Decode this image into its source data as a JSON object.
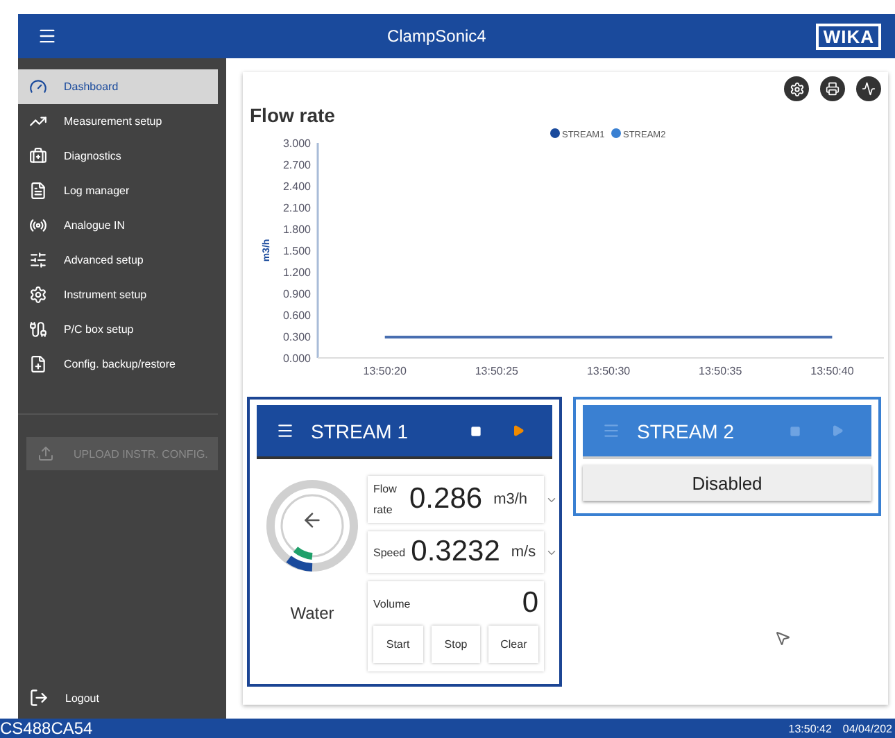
{
  "header": {
    "title": "ClampSonic4",
    "logo": "WIKA"
  },
  "sidebar": {
    "items": [
      {
        "label": "Dashboard",
        "selected": true
      },
      {
        "label": "Measurement setup",
        "selected": false
      },
      {
        "label": "Diagnostics",
        "selected": false
      },
      {
        "label": "Log manager",
        "selected": false
      },
      {
        "label": "Analogue IN",
        "selected": false
      },
      {
        "label": "Advanced setup",
        "selected": false
      },
      {
        "label": "Instrument setup",
        "selected": false
      },
      {
        "label": "P/C box setup",
        "selected": false
      },
      {
        "label": "Config. backup/restore",
        "selected": false
      }
    ],
    "upload": {
      "label": "UPLOAD INSTR. CONFIG.",
      "disabled": true
    },
    "logout": "Logout"
  },
  "chart": {
    "title": "Flow rate",
    "chart_data": {
      "type": "line",
      "ylabel": "m3/h",
      "categories": [
        "13:50:20",
        "13:50:25",
        "13:50:30",
        "13:50:35",
        "13:50:40"
      ],
      "ylim": [
        0,
        3
      ],
      "yticks": [
        {
          "value": 0,
          "label": "0.000"
        },
        {
          "value": 0.3,
          "label": "0.300"
        },
        {
          "value": 0.6,
          "label": "0.600"
        },
        {
          "value": 0.9,
          "label": "0.900"
        },
        {
          "value": 1.2,
          "label": "1.200"
        },
        {
          "value": 1.5,
          "label": "1.500"
        },
        {
          "value": 1.8,
          "label": "1.800"
        },
        {
          "value": 2.1,
          "label": "2.100"
        },
        {
          "value": 2.4,
          "label": "2.400"
        },
        {
          "value": 2.7,
          "label": "2.700"
        },
        {
          "value": 3,
          "label": "3.000"
        }
      ],
      "series": [
        {
          "name": "STREAM1",
          "color": "#1a4a9c",
          "values": [
            0.29,
            0.29,
            0.29,
            0.29,
            0.29
          ]
        },
        {
          "name": "STREAM2",
          "color": "#3a80d2",
          "values": [
            null,
            null,
            null,
            null,
            null
          ]
        }
      ]
    }
  },
  "streams": [
    {
      "title": "STREAM 1",
      "disabled": false,
      "medium": "Water",
      "readings": [
        {
          "kind": "measure",
          "label": "Flow rate",
          "value": "0.286",
          "unit": "m3/h"
        },
        {
          "kind": "measure",
          "label": "Speed",
          "value": "0.3232",
          "unit": "m/s"
        },
        {
          "kind": "totalizer",
          "label": "Volume",
          "value": "0",
          "buttons": [
            "Start",
            "Stop",
            "Clear"
          ]
        }
      ]
    },
    {
      "title": "STREAM 2",
      "disabled": true,
      "status": "Disabled"
    }
  ],
  "status_bar": {
    "device": "CS488CA54",
    "time": "13:50:42",
    "date": "04/04/202"
  }
}
